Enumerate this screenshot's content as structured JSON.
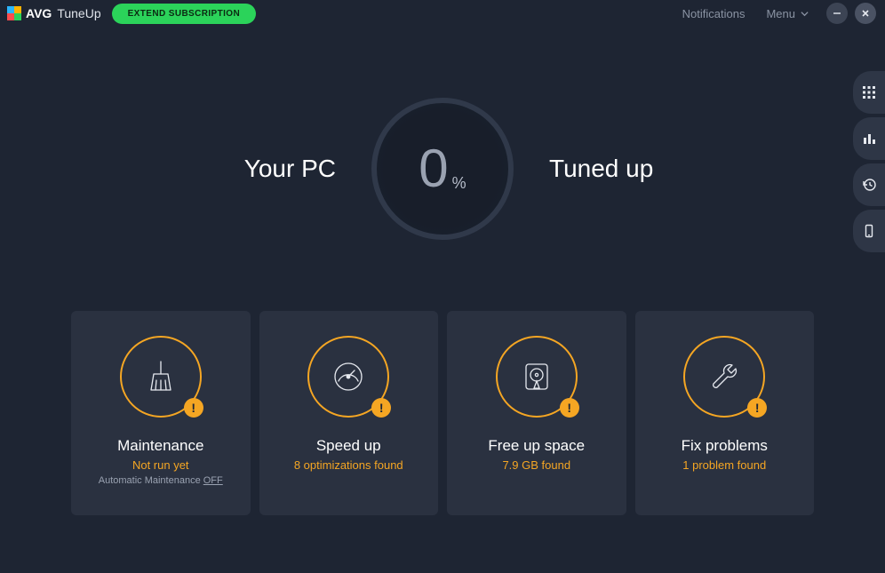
{
  "header": {
    "brand": "AVG",
    "product": "TuneUp",
    "extend_label": "EXTEND SUBSCRIPTION",
    "notifications": "Notifications",
    "menu": "Menu"
  },
  "hero": {
    "left": "Your PC",
    "value": "0",
    "unit": "%",
    "right": "Tuned up"
  },
  "cards": [
    {
      "icon": "broom",
      "title": "Maintenance",
      "sub": "Not run yet",
      "extra_prefix": "Automatic Maintenance ",
      "extra_state": "OFF"
    },
    {
      "icon": "gauge",
      "title": "Speed up",
      "sub": "8 optimizations found"
    },
    {
      "icon": "disk",
      "title": "Free up space",
      "sub": "7.9 GB found"
    },
    {
      "icon": "wrench",
      "title": "Fix problems",
      "sub": "1 problem found"
    }
  ],
  "badge_glyph": "!"
}
